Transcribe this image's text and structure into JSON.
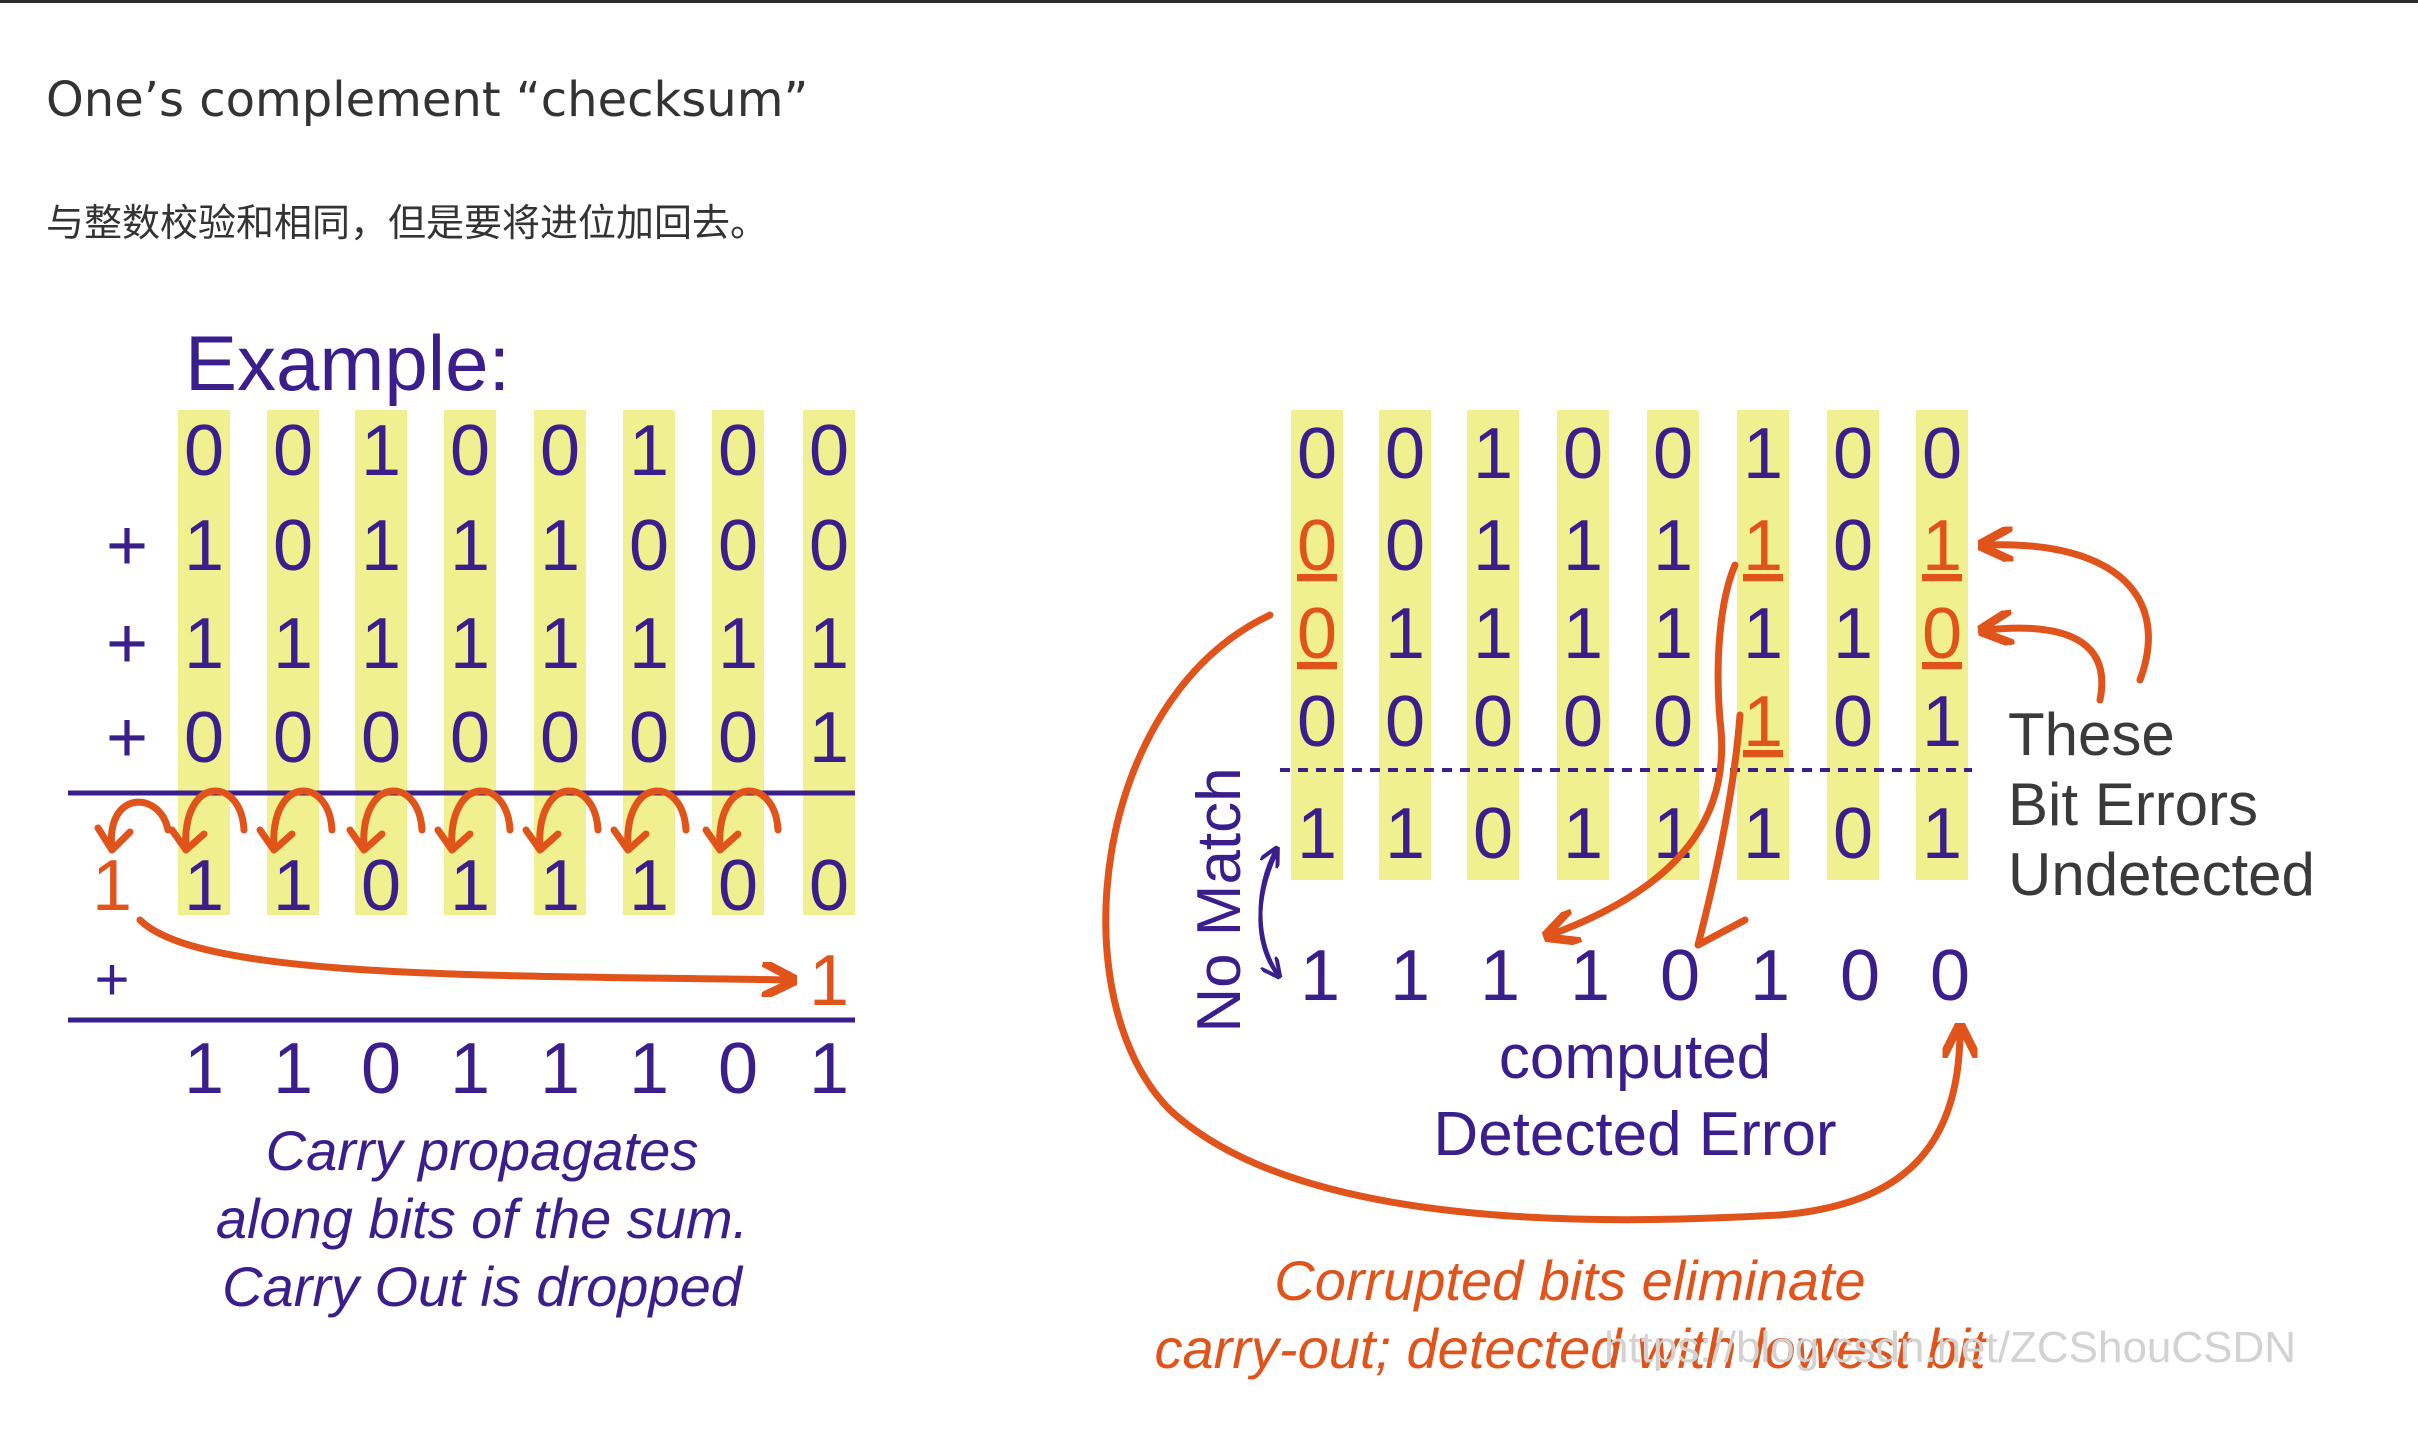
{
  "heading": "One’s complement “checksum”",
  "subheading": "与整数校验和相同，但是要将进位加回去。",
  "colors": {
    "text_purple": "#3a1f8c",
    "highlight_yellow": "#f0f090",
    "arrow_orange": "#e0541c",
    "gray_text": "#3a3a3a",
    "watermark": "#d2d2d2"
  },
  "left": {
    "example_label": "Example:",
    "rows": [
      "00100100",
      "10111000",
      "11111111",
      "00000001"
    ],
    "signs": [
      "+",
      "+",
      "+"
    ],
    "carry_row": "1",
    "partial_sum": "11011100",
    "plus_sign": "+",
    "carry_add": "1",
    "final_sum": "11011101",
    "caption": [
      "Carry propagates",
      "along bits of the sum.",
      "Carry Out is dropped"
    ]
  },
  "right": {
    "rows": [
      "00100100",
      "00111101",
      "01111110",
      "00000101"
    ],
    "checksum_row": "11011101",
    "computed_row": "11110100",
    "corrupted_cells": [
      [
        1,
        0
      ],
      [
        1,
        5
      ],
      [
        1,
        7
      ],
      [
        2,
        0
      ],
      [
        2,
        7
      ],
      [
        3,
        5
      ]
    ],
    "no_match_label": "No Match",
    "computed_label": "computed",
    "detected_label": "Detected Error",
    "annotation": [
      "These",
      "Bit Errors",
      "Undetected"
    ],
    "caption": [
      "Corrupted bits eliminate",
      "carry-out; detected with lowest bit"
    ]
  },
  "watermark": "https://blog.csdn.net/ZCShouCSDN"
}
